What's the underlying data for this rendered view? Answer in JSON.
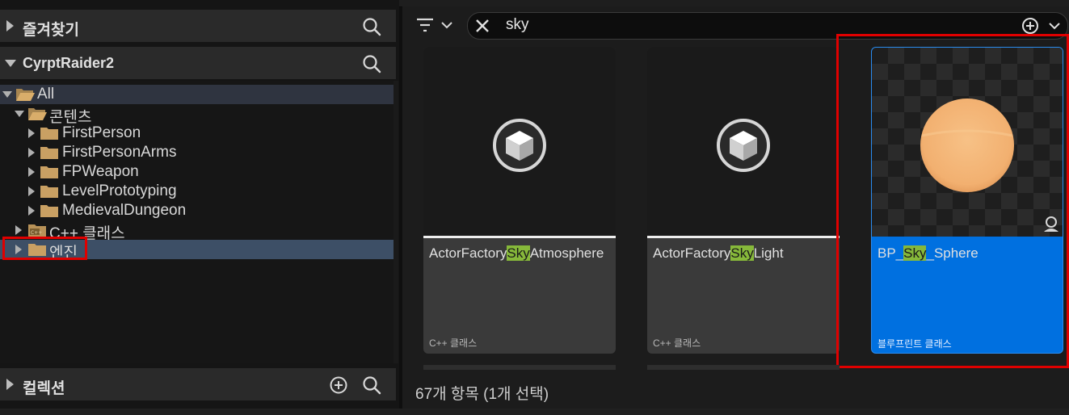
{
  "favorites": {
    "label": "즐겨찾기"
  },
  "project": {
    "label": "CyrptRaider2"
  },
  "tree": [
    {
      "label": "All"
    },
    {
      "label": "콘텐츠"
    },
    {
      "label": "FirstPerson"
    },
    {
      "label": "FirstPersonArms"
    },
    {
      "label": "FPWeapon"
    },
    {
      "label": "LevelPrototyping"
    },
    {
      "label": "MedievalDungeon"
    },
    {
      "label": "C++ 클래스"
    },
    {
      "label": "엔진"
    }
  ],
  "collections": {
    "label": "컬렉션"
  },
  "search": {
    "value": "sky"
  },
  "assets": [
    {
      "pre": "ActorFactory",
      "match": "Sky",
      "post": "Atmosphere",
      "type": "C++ 클래스"
    },
    {
      "pre": "ActorFactory",
      "match": "Sky",
      "post": "Light",
      "type": "C++ 클래스"
    },
    {
      "pre": "BP_",
      "match": "Sky",
      "post": "_Sphere",
      "type": "블루프린트 클래스"
    }
  ],
  "status": {
    "count_text": "67개 항목 (1개 선택)"
  },
  "colors": {
    "highlight": "#86b83a",
    "selected_card": "#0070e0",
    "selected_row": "#3d4f66",
    "annotation": "#e00000",
    "folder": "#c9a063"
  }
}
